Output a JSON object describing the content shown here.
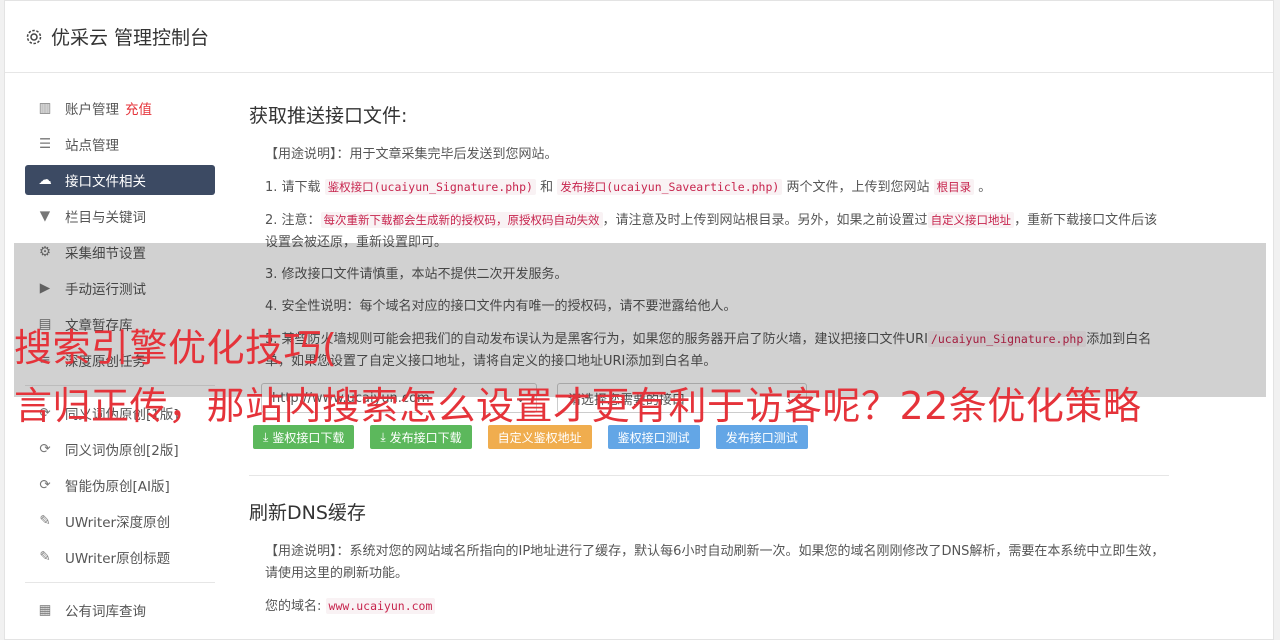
{
  "app": {
    "title": "优采云 管理控制台"
  },
  "sidebar": {
    "items": [
      {
        "label": "账户管理",
        "badge": "充值"
      },
      {
        "label": "站点管理"
      },
      {
        "label": "接口文件相关",
        "active": true
      },
      {
        "label": "栏目与关键词"
      },
      {
        "label": "采集细节设置"
      },
      {
        "label": "手动运行测试"
      },
      {
        "label": "文章暂存库"
      },
      {
        "label": "深度原创任务"
      },
      {
        "label": "同义词伪原创[1版]"
      },
      {
        "label": "同义词伪原创[2版]"
      },
      {
        "label": "智能伪原创[AI版]"
      },
      {
        "label": "UWriter深度原创"
      },
      {
        "label": "UWriter原创标题"
      },
      {
        "label": "公有词库查询"
      }
    ]
  },
  "section1": {
    "title": "获取推送接口文件:",
    "usage": "【用途说明】：用于文章采集完毕后发送到您网站。",
    "p1_a": "1. 请下载",
    "p1_code1": "鉴权接口(ucaiyun_Signature.php)",
    "p1_b": "和",
    "p1_code2": "发布接口(ucaiyun_Savearticle.php)",
    "p1_c": "两个文件，上传到您网站",
    "p1_code3": "根目录",
    "p1_d": "。",
    "p2_a": "2. 注意：",
    "p2_code1": "每次重新下载都会生成新的授权码，原授权码自动失效",
    "p2_b": "，请注意及时上传到网站根目录。另外，如果之前设置过",
    "p2_code2": "自定义接口地址",
    "p2_c": "，重新下载接口文件后该设置会被还原，重新设置即可。",
    "p3": "3. 修改接口文件请慎重，本站不提供二次开发服务。",
    "p4": "4. 安全性说明：每个域名对应的接口文件内有唯一的授权码，请不要泄露给他人。",
    "p5_a": "5. 某些防火墙规则可能会把我们的自动发布误认为是黑客行为，如果您的服务器开启了防火墙，建议把接口文件URI",
    "p5_code": "/ucaiyun_Signature.php",
    "p5_b": "添加到白名单，如果您设置了自定义接口地址，请将自定义的接口地址URI添加到白名单。",
    "site_select": "http://www.ucaiyun.com",
    "file_select": "请选择您需要的接口",
    "buttons": [
      "鉴权接口下载",
      "发布接口下载",
      "自定义鉴权地址",
      "鉴权接口测试",
      "发布接口测试"
    ]
  },
  "section2": {
    "title": "刷新DNS缓存",
    "usage": "【用途说明】：系统对您的网站域名所指向的IP地址进行了缓存，默认每6小时自动刷新一次。如果您的域名刚刚修改了DNS解析，需要在本系统中立即生效，请使用这里的刷新功能。",
    "domain_label": "您的域名:",
    "domain_value": "www.ucaiyun.com"
  },
  "overlay": {
    "line1": "搜索引擎优化技巧(",
    "line2": "言归正传，那站内搜索怎么设置才更有利于访客呢？22条优化策略"
  },
  "colors": {
    "active_bg": "#3c4a63",
    "overlay_text": "#e5333a",
    "green": "#5cb85c",
    "orange": "#f0ad4e",
    "blue": "#5bc0de"
  }
}
